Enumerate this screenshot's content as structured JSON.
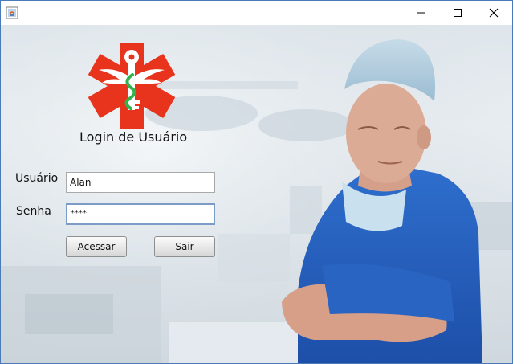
{
  "window": {
    "icon": "java-app-icon",
    "controls": [
      "minimize-icon",
      "maximize-icon",
      "close-icon"
    ]
  },
  "login": {
    "title": "Login de Usuário",
    "username_label": "Usuário",
    "username_value": "Alan",
    "password_label": "Senha",
    "password_value": "****",
    "submit_label": "Acessar",
    "exit_label": "Sair"
  },
  "logo": {
    "icon": "medical-caduceus-logo",
    "colors": {
      "cross": "#e8341c",
      "symbol": "#ffffff",
      "serpent": "#2fb34a"
    }
  },
  "colors": {
    "focus_border": "#7a9cc6",
    "window_border": "#4a7ab8"
  }
}
